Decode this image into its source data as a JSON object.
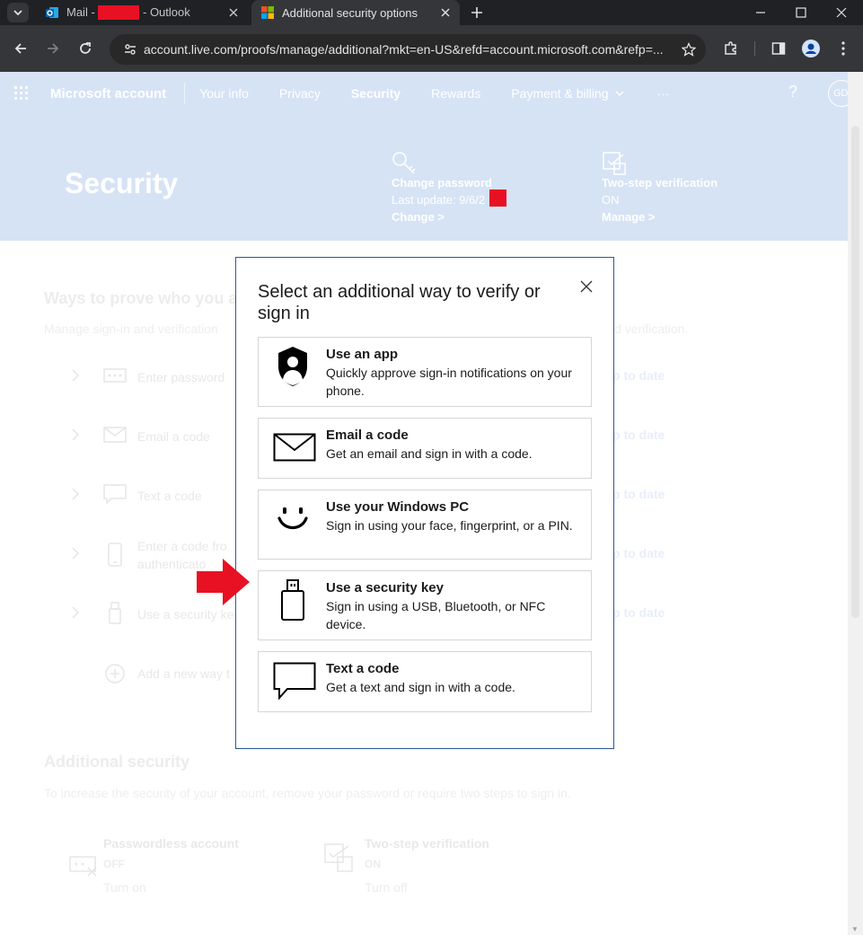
{
  "browser": {
    "tabs": [
      {
        "title_prefix": "Mail - ",
        "title_suffix": " - Outlook",
        "active": false
      },
      {
        "title": "Additional security options",
        "active": true
      }
    ],
    "url": "account.live.com/proofs/manage/additional?mkt=en-US&refd=account.microsoft.com&refp=..."
  },
  "header": {
    "brand": "Microsoft account",
    "nav": [
      "Your info",
      "Privacy",
      "Security",
      "Rewards",
      "Payment & billing"
    ],
    "more": "···",
    "help": "?",
    "avatar_initials": "GD"
  },
  "hero": {
    "title": "Security",
    "change_password": {
      "title": "Change password",
      "detail": "Last update: 9/6/2",
      "link": "Change >"
    },
    "two_step": {
      "title": "Two-step verification",
      "status": "ON",
      "link": "Manage >"
    }
  },
  "ways_section": {
    "title": "Ways to prove who you a",
    "desc_left": "Manage sign-in and verification",
    "desc_right": "d verification.",
    "rows": [
      {
        "label": "Enter password",
        "status": "p to date"
      },
      {
        "label": "Email a code",
        "status": "p to date"
      },
      {
        "label": "Text a code",
        "status": "p to date"
      },
      {
        "label_line1": "Enter a code fro",
        "label_line2": "authenticato",
        "status": "p to date"
      },
      {
        "label": "Use a security ke",
        "status": "p to date"
      }
    ],
    "add_new": "Add a new way t"
  },
  "additional_security": {
    "title": "Additional security",
    "desc": "To increase the security of your account, remove your password or require two steps to sign in.",
    "cards": [
      {
        "title": "Passwordless account",
        "state": "OFF",
        "link": "Turn on"
      },
      {
        "title": "Two-step verification",
        "state": "ON",
        "link": "Turn off"
      }
    ]
  },
  "modal": {
    "title": "Select an additional way to verify or sign in",
    "options": [
      {
        "title": "Use an app",
        "desc": "Quickly approve sign-in notifications on your phone.",
        "icon": "authenticator-app-icon"
      },
      {
        "title": "Email a code",
        "desc": "Get an email and sign in with a code.",
        "icon": "envelope-icon"
      },
      {
        "title": "Use your Windows PC",
        "desc": "Sign in using your face, fingerprint, or a PIN.",
        "icon": "smiley-face-icon"
      },
      {
        "title": "Use a security key",
        "desc": "Sign in using a USB, Bluetooth, or NFC device.",
        "icon": "usb-key-icon"
      },
      {
        "title": "Text a code",
        "desc": "Get a text and sign in with a code.",
        "icon": "chat-bubble-icon"
      }
    ]
  },
  "colors": {
    "accent": "#2b579a",
    "annotation_arrow": "#e81123",
    "header_bg": "#d6e3f5"
  }
}
